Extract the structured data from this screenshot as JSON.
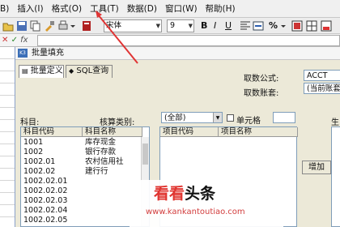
{
  "menu": {
    "partial_file": "B)",
    "insert": "插入(I)",
    "format": "格式(O)",
    "tools": "工具(T)",
    "data": "数据(D)",
    "window": "窗口(W)",
    "help": "帮助(H)"
  },
  "toolbar": {
    "font_name": "宋体",
    "font_size": "9",
    "bold": "B",
    "italic": "I",
    "underline": "U",
    "percent": "%"
  },
  "formula_bar": {
    "fx_symbol": "fx",
    "value": ""
  },
  "dialog": {
    "title": "批量填充",
    "tabs": [
      {
        "label": "批量定义"
      },
      {
        "label": "SQL查询"
      }
    ],
    "formula_label": "取数公式:",
    "formula_value": "ACCT",
    "period_label": "取数账套:",
    "period_value": "(当前账套:",
    "subject_label": "科目:",
    "category_label": "核算类别:",
    "category_value": "(全部)",
    "cell_checkbox_label": "单元格",
    "cell_checked": false,
    "subject_table": {
      "columns": [
        "科目代码",
        "科目名称"
      ],
      "rows": [
        {
          "code": "1001",
          "name": "库存现金"
        },
        {
          "code": "1002",
          "name": "银行存款"
        },
        {
          "code": "1002.01",
          "name": "农村信用社"
        },
        {
          "code": "1002.02",
          "name": "建行行"
        },
        {
          "code": "1002.02.01",
          "name": ""
        },
        {
          "code": "1002.02.02",
          "name": ""
        },
        {
          "code": "1002.02.03",
          "name": ""
        },
        {
          "code": "1002.02.04",
          "name": ""
        },
        {
          "code": "1002.02.05",
          "name": ""
        }
      ]
    },
    "item_table": {
      "columns": [
        "项目代码",
        "项目名称"
      ]
    },
    "add_button": "增加",
    "right_partial_label": "生"
  },
  "watermark": {
    "brand_part1": "看看",
    "brand_part2": "头条",
    "url": "www.kankantoutiao.com",
    "brand_color": "#e0342f"
  },
  "annotation": {
    "arrow_color": "#e03434"
  }
}
